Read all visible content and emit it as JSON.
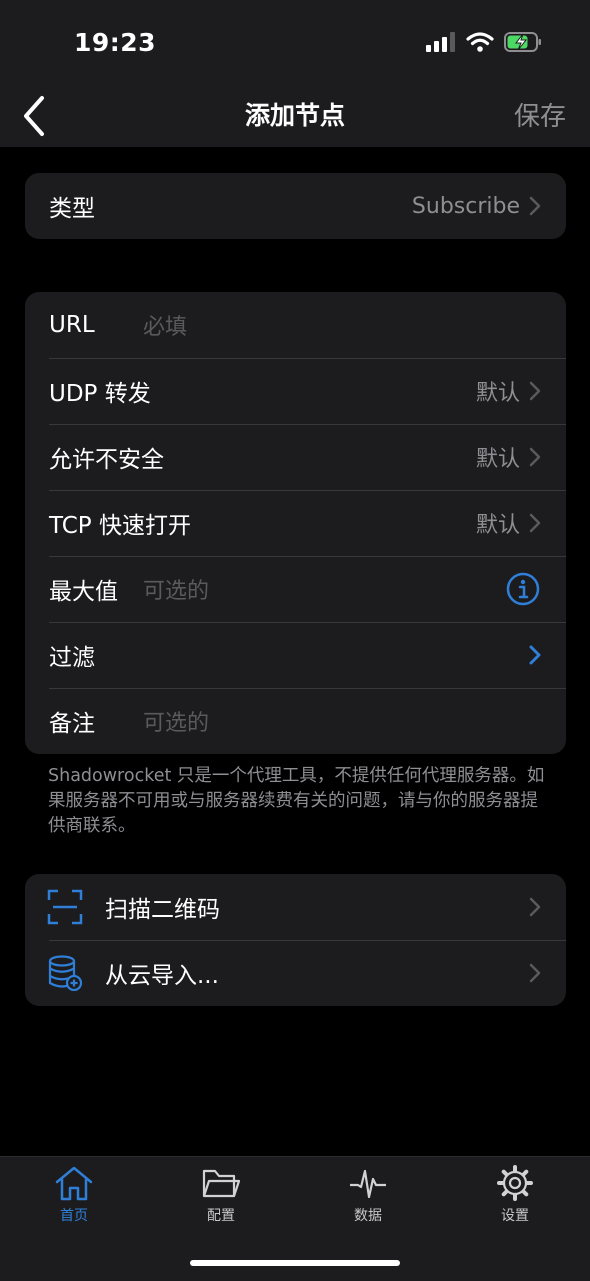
{
  "status_bar": {
    "time": "19:23"
  },
  "nav": {
    "title": "添加节点",
    "back_icon": "chevron-left-icon",
    "save_label": "保存"
  },
  "type_row": {
    "label": "类型",
    "value": "Subscribe"
  },
  "settings": {
    "url": {
      "label": "URL",
      "placeholder": "必填"
    },
    "udp": {
      "label": "UDP 转发",
      "value": "默认"
    },
    "insecure": {
      "label": "允许不安全",
      "value": "默认"
    },
    "tfo": {
      "label": "TCP 快速打开",
      "value": "默认"
    },
    "max": {
      "label": "最大值",
      "placeholder": "可选的"
    },
    "filter": {
      "label": "过滤"
    },
    "note": {
      "label": "备注",
      "placeholder": "可选的"
    }
  },
  "footnote": "Shadowrocket 只是一个代理工具，不提供任何代理服务器。如果服务器不可用或与服务器续费有关的问题，请与你的服务器提供商联系。",
  "actions": {
    "scan": {
      "label": "扫描二维码",
      "icon": "qr-scan-icon"
    },
    "cloud": {
      "label": "从云导入...",
      "icon": "database-add-icon"
    }
  },
  "tabs": [
    {
      "label": "首页",
      "icon": "home-icon",
      "active": true
    },
    {
      "label": "配置",
      "icon": "folder-icon",
      "active": false
    },
    {
      "label": "数据",
      "icon": "pulse-icon",
      "active": false
    },
    {
      "label": "设置",
      "icon": "gear-icon",
      "active": false
    }
  ],
  "colors": {
    "accent": "#2f7fd8",
    "background": "#000000",
    "card": "#1c1c1e",
    "secondary_text": "#8e8e93",
    "battery_charging": "#4cd964"
  }
}
